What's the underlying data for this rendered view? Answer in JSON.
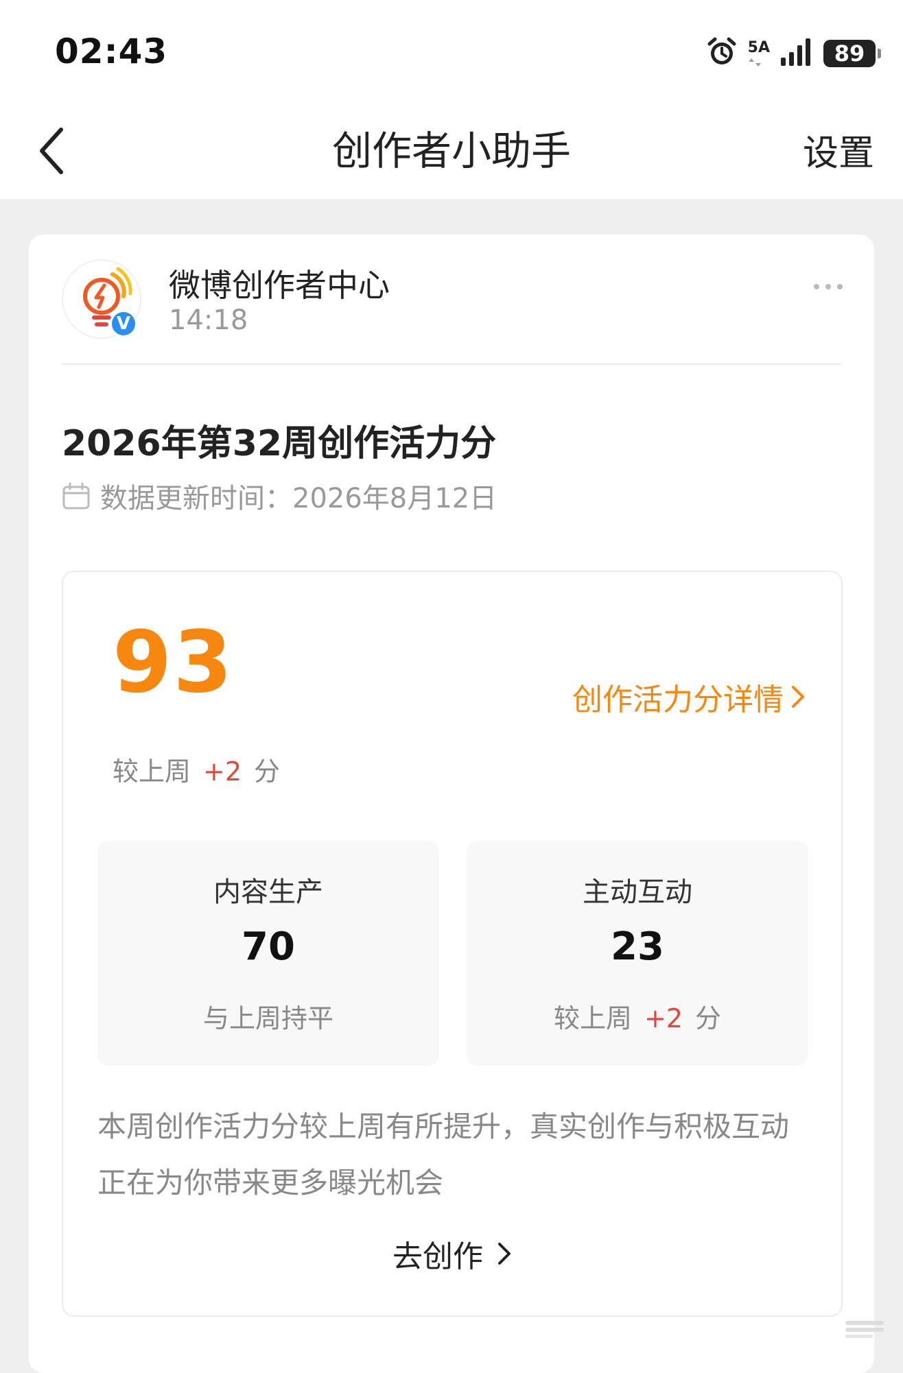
{
  "status_bar": {
    "time": "02:43",
    "network": "5A",
    "battery": "89",
    "icons": [
      "alarm-icon",
      "signal-icon",
      "battery-icon"
    ]
  },
  "nav": {
    "back_icon": "chevron-left-icon",
    "title": "创作者小助手",
    "right_action": "设置"
  },
  "message": {
    "sender": {
      "name": "微博创作者中心",
      "time": "14:18",
      "avatar_icon": "lightbulb-icon",
      "verified_badge": "V"
    },
    "more_icon": "more-dots-icon",
    "title": "2026年第32周创作活力分",
    "update_icon": "calendar-icon",
    "update_text": "数据更新时间：2026年8月12日",
    "score": {
      "value": "93",
      "detail_link": "创作活力分详情",
      "compare_prefix": "较上周",
      "compare_delta": "+2",
      "compare_suffix": "分"
    },
    "sub_scores": [
      {
        "label": "内容生产",
        "value": "70",
        "note": "与上周持平"
      },
      {
        "label": "主动互动",
        "value": "23",
        "note_prefix": "较上周",
        "note_delta": "+2",
        "note_suffix": "分"
      }
    ],
    "summary": "本周创作活力分较上周有所提升，真实创作与积极互动正在为你带来更多曝光机会",
    "cta": "去创作"
  },
  "colors": {
    "accent": "#f7870e",
    "delta": "#e2453c",
    "verify": "#2a8df2",
    "background": "#efefef"
  }
}
